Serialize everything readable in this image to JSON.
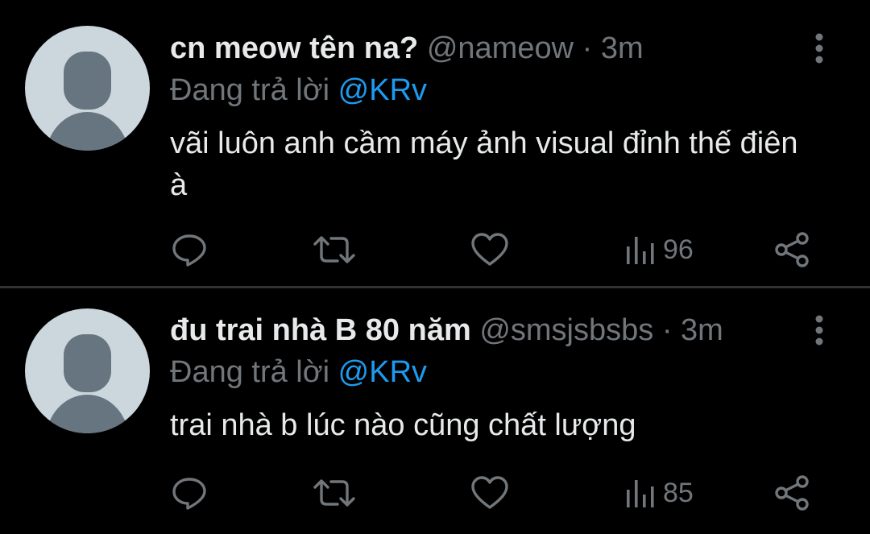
{
  "tweets": [
    {
      "display_name": "cn meow tên na?",
      "handle": "@nameow",
      "separator": "·",
      "time": "3m",
      "reply_prefix": "Đang trả lời",
      "reply_to": "@KRv",
      "text": "vãi luôn anh cầm máy ảnh visual đỉnh thế điên à",
      "views": "96"
    },
    {
      "display_name": "đu trai nhà B 80 năm",
      "handle": "@smsjsbsbs",
      "separator": "·",
      "time": "3m",
      "reply_prefix": "Đang trả lời",
      "reply_to": "@KRv",
      "text": "trai nhà b lúc nào cũng chất lượng",
      "views": "85"
    }
  ],
  "icons": {
    "reply": "reply-icon",
    "retweet": "retweet-icon",
    "like": "heart-icon",
    "views": "views-chart-icon",
    "share": "share-icon",
    "more": "more-vertical-icon",
    "avatar": "default-avatar-icon"
  },
  "colors": {
    "background": "#000000",
    "text": "#e7e9ea",
    "muted": "#71767b",
    "link": "#1d9bf0",
    "divider": "#2f3336",
    "avatar_bg": "#ccd6dd",
    "avatar_fg": "#66757f"
  }
}
